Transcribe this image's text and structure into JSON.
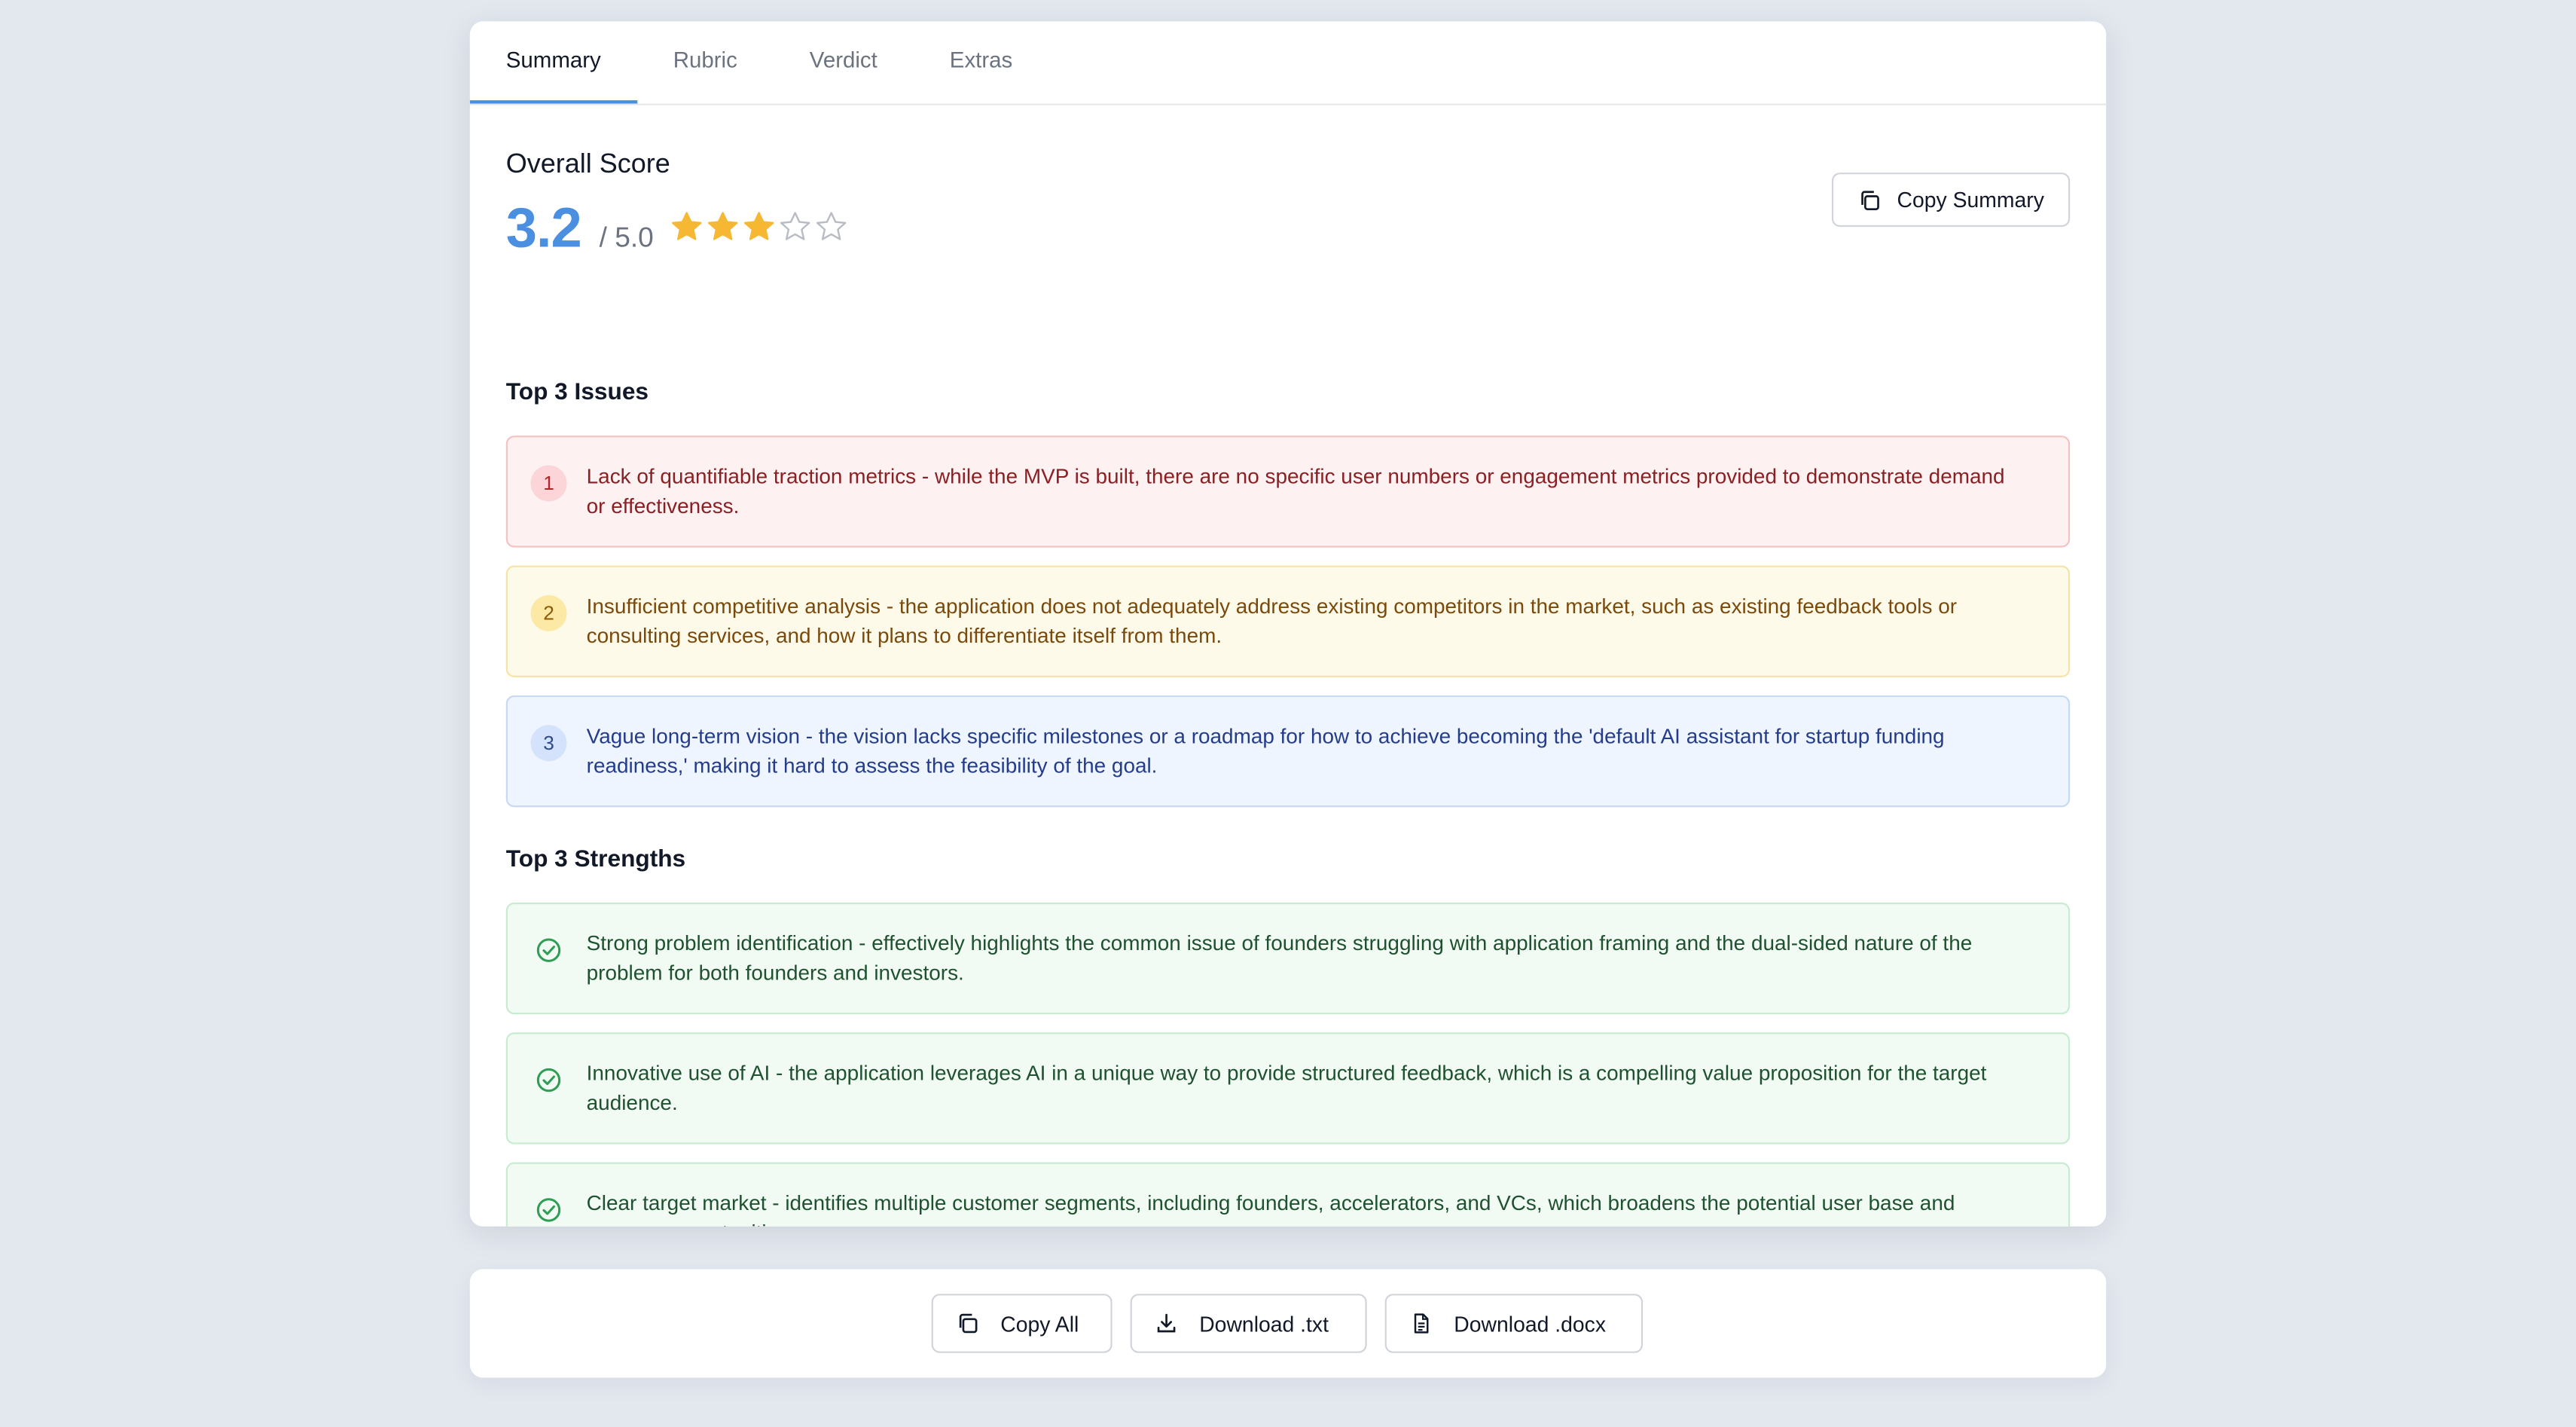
{
  "tabs": [
    {
      "label": "Summary",
      "active": true
    },
    {
      "label": "Rubric",
      "active": false
    },
    {
      "label": "Verdict",
      "active": false
    },
    {
      "label": "Extras",
      "active": false
    }
  ],
  "overall": {
    "title": "Overall Score",
    "score": "3.2",
    "out_of": "/ 5.0",
    "stars_filled": 3,
    "stars_total": 5,
    "star_color": "#f6b833"
  },
  "copy_summary_label": "Copy Summary",
  "issues": {
    "heading": "Top 3 Issues",
    "items": [
      {
        "num": "1",
        "text": "Lack of quantifiable traction metrics - while the MVP is built, there are no specific user numbers or engagement metrics provided to demonstrate demand or effectiveness."
      },
      {
        "num": "2",
        "text": "Insufficient competitive analysis - the application does not adequately address existing competitors in the market, such as existing feedback tools or consulting services, and how it plans to differentiate itself from them."
      },
      {
        "num": "3",
        "text": "Vague long-term vision - the vision lacks specific milestones or a roadmap for how to achieve becoming the 'default AI assistant for startup funding readiness,' making it hard to assess the feasibility of the goal."
      }
    ]
  },
  "strengths": {
    "heading": "Top 3 Strengths",
    "items": [
      {
        "text": "Strong problem identification - effectively highlights the common issue of founders struggling with application framing and the dual-sided nature of the problem for both founders and investors."
      },
      {
        "text": "Innovative use of AI - the application leverages AI in a unique way to provide structured feedback, which is a compelling value proposition for the target audience."
      },
      {
        "text": "Clear target market - identifies multiple customer segments, including founders, accelerators, and VCs, which broadens the potential user base and revenue opportunities."
      }
    ]
  },
  "footer": {
    "copy_all": "Copy All",
    "download_txt": "Download .txt",
    "download_docx": "Download .docx"
  }
}
